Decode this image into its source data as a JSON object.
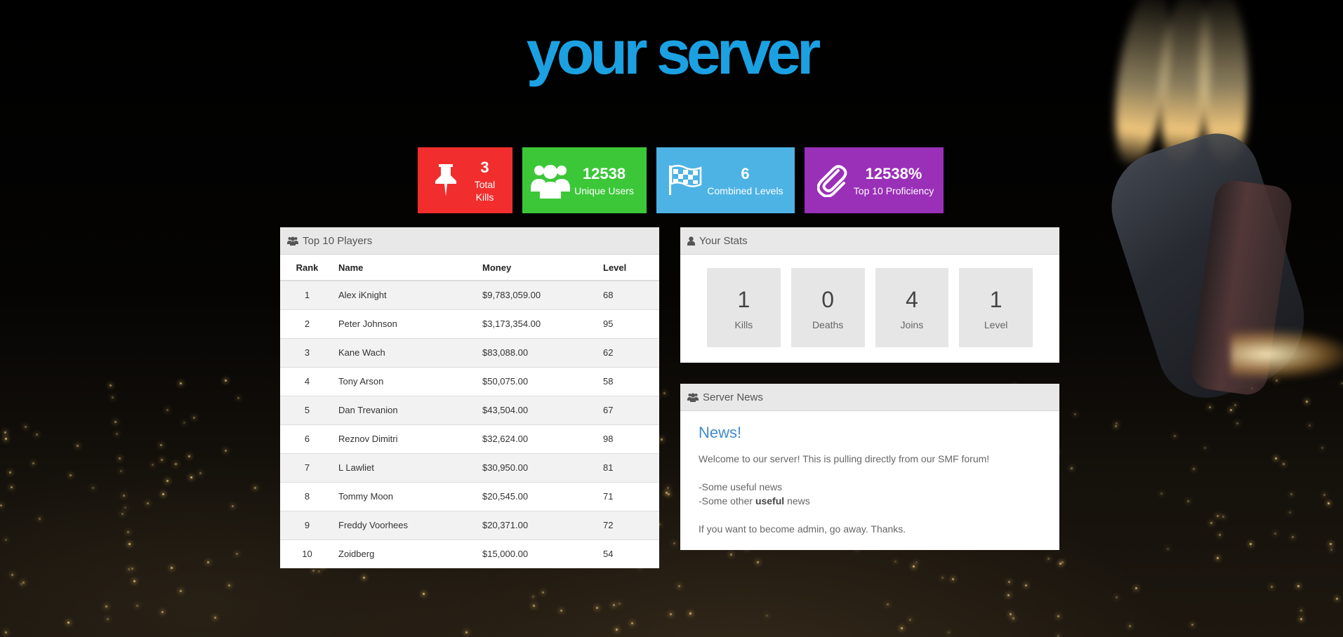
{
  "site": {
    "title": "your server"
  },
  "tiles": [
    {
      "value": "3",
      "label": "Total Kills",
      "color": "#f22d2d",
      "icon": "pushpin-icon"
    },
    {
      "value": "12538",
      "label": "Unique Users",
      "color": "#3cc739",
      "icon": "users-icon"
    },
    {
      "value": "6",
      "label": "Combined Levels",
      "color": "#4db3e5",
      "icon": "flag-icon"
    },
    {
      "value": "12538%",
      "label": "Top 10 Proficiency",
      "color": "#9a2fb8",
      "icon": "paperclip-icon"
    }
  ],
  "top_players": {
    "title": "Top 10 Players",
    "icon": "users-icon",
    "columns": [
      "Rank",
      "Name",
      "Money",
      "Level"
    ],
    "rows": [
      [
        "1",
        "Alex iKnight",
        "$9,783,059.00",
        "68"
      ],
      [
        "2",
        "Peter Johnson",
        "$3,173,354.00",
        "95"
      ],
      [
        "3",
        "Kane Wach",
        "$83,088.00",
        "62"
      ],
      [
        "4",
        "Tony Arson",
        "$50,075.00",
        "58"
      ],
      [
        "5",
        "Dan Trevanion",
        "$43,504.00",
        "67"
      ],
      [
        "6",
        "Reznov Dimitri",
        "$32,624.00",
        "98"
      ],
      [
        "7",
        "L Lawliet",
        "$30,950.00",
        "81"
      ],
      [
        "8",
        "Tommy Moon",
        "$20,545.00",
        "71"
      ],
      [
        "9",
        "Freddy Voorhees",
        "$20,371.00",
        "72"
      ],
      [
        "10",
        "Zoidberg",
        "$15,000.00",
        "54"
      ]
    ]
  },
  "your_stats": {
    "title": "Your Stats",
    "icon": "user-icon",
    "items": [
      {
        "value": "1",
        "label": "Kills"
      },
      {
        "value": "0",
        "label": "Deaths"
      },
      {
        "value": "4",
        "label": "Joins"
      },
      {
        "value": "1",
        "label": "Level"
      }
    ]
  },
  "server_news": {
    "title": "Server News",
    "icon": "users-icon",
    "headline": "News!",
    "intro": "Welcome to our server! This is pulling directly from our SMF forum!",
    "line1": "-Some useful news",
    "line2_prefix": "-Some other ",
    "line2_bold": "useful",
    "line2_suffix": " news",
    "outro": "If you want to become admin, go away. Thanks."
  }
}
